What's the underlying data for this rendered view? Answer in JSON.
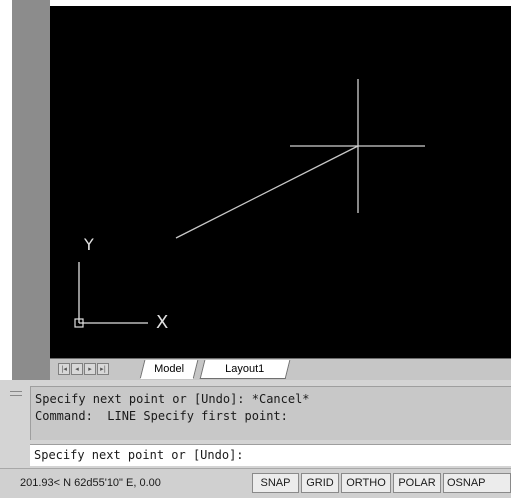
{
  "viewport": {
    "background": "#000000",
    "crosshair_color": "#d0d0d0",
    "ucs": {
      "x_label": "X",
      "y_label": "Y"
    }
  },
  "layout_tabs": {
    "nav_buttons": [
      "first-icon",
      "prev-icon",
      "next-icon",
      "last-icon"
    ],
    "tabs": [
      {
        "label": "Model",
        "active": true
      },
      {
        "label": "Layout1",
        "active": false
      }
    ]
  },
  "command_window": {
    "history": [
      "Specify next point or [Undo]: *Cancel*",
      "Command:  LINE Specify first point:"
    ],
    "prompt": "Specify next point or [Undo]:"
  },
  "status_bar": {
    "coordinates": "201.93< N 62d55'10\" E, 0.00",
    "toggles": [
      "SNAP",
      "GRID",
      "ORTHO",
      "POLAR",
      "OSNAP"
    ]
  }
}
